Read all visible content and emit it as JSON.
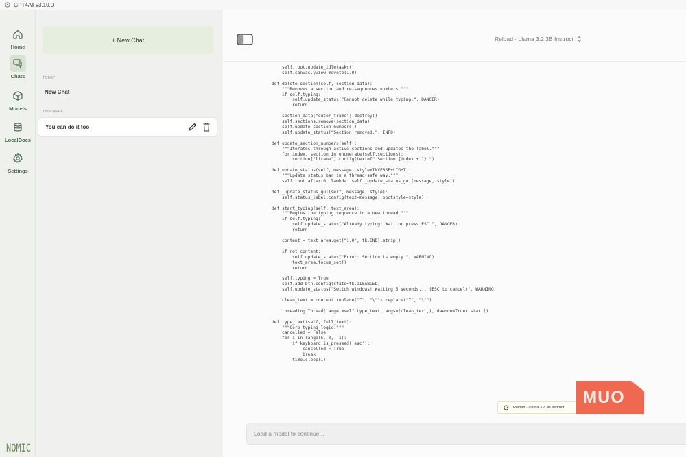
{
  "window": {
    "title": "GPT4All v3.10.0"
  },
  "rail": {
    "items": [
      {
        "label": "Home",
        "icon": "home-icon"
      },
      {
        "label": "Chats",
        "icon": "chats-icon"
      },
      {
        "label": "Models",
        "icon": "models-icon"
      },
      {
        "label": "LocalDocs",
        "icon": "localdocs-icon"
      },
      {
        "label": "Settings",
        "icon": "settings-icon"
      }
    ],
    "active": "Chats",
    "logo": "NOMIC"
  },
  "chat_panel": {
    "new_chat_label": "+ New Chat",
    "sections": [
      {
        "label": "TODAY",
        "chats": [
          {
            "title": "New Chat"
          }
        ]
      },
      {
        "label": "THIS WEEK",
        "chats": [
          {
            "title": "You can do it too",
            "selected": true
          }
        ]
      }
    ]
  },
  "header": {
    "model_selector": "Reload · Llama 3.2 3B Instruct",
    "chevron": "⌃⌄"
  },
  "code_lines": [
    "    self.root.update_idletasks()",
    "    self.canvas.yview_moveto(1.0)",
    "",
    "def delete_section(self, section_data):",
    "    \"\"\"Removes a section and re-sequences numbers.\"\"\"",
    "    if self.typing:",
    "        self.update_status(\"Cannot delete while typing.\", DANGER)",
    "        return",
    "",
    "    section_data[\"outer_frame\"].destroy()",
    "    self.sections.remove(section_data)",
    "    self.update_section_numbers()",
    "    self.update_status(\"Section removed.\", INFO)",
    "",
    "def update_section_numbers(self):",
    "    \"\"\"Iterates through active sections and updates the label.\"\"\"",
    "    for index, section in enumerate(self.sections):",
    "        section[\"lframe\"].config(text=f\" Section {index + 1} \")",
    "",
    "def update_status(self, message, style=INVERSE+LIGHT):",
    "    \"\"\"Update status bar in a thread-safe way.\"\"\"",
    "    self.root.after(0, lambda: self._update_status_gui(message, style))",
    "",
    "def _update_status_gui(self, message, style):",
    "    self.status_label.config(text=message, bootstyle=style)",
    "",
    "def start_typing(self, text_area):",
    "    \"\"\"Begins the typing sequence in a new thread.\"\"\"",
    "    if self.typing:",
    "        self.update_status(\"Already typing! Wait or press ESC.\", DANGER)",
    "        return",
    "",
    "    content = text_area.get(\"1.0\", tk.END).strip()",
    "",
    "    if not content:",
    "        self.update_status(\"Error: Section is empty.\", WARNING)",
    "        text_area.focus_set()",
    "        return",
    "",
    "    self.typing = True",
    "    self.add_btn.config(state=tk.DISABLED)",
    "    self.update_status(\"Switch windows! Waiting 5 seconds... (ESC to cancel)\", WARNING)",
    "",
    "    clean_text = content.replace(\"“\", \"\\\"\").replace(\"”\", \"\\\"\")",
    "",
    "    threading.Thread(target=self.type_text, args=(clean_text,), daemon=True).start()",
    "",
    "def type_text(self, full_text):",
    "    \"\"\"Core typing logic.\"\"\"",
    "    cancelled = False",
    "    for i in range(5, 0, -1):",
    "        if keyboard.is_pressed('esc'):",
    "            cancelled = True",
    "            break",
    "        time.sleep(1)"
  ],
  "toast": {
    "text": "Reload · Llama 3.2 3B Instruct"
  },
  "watermark": {
    "text": "MUO",
    "color": "#ef6850"
  },
  "input": {
    "placeholder": "Load a model to continue..."
  },
  "colors": {
    "accent": "#4d6b4d",
    "new_chat_bg": "#e6eedf",
    "rail_active": "#d9e2d2"
  }
}
